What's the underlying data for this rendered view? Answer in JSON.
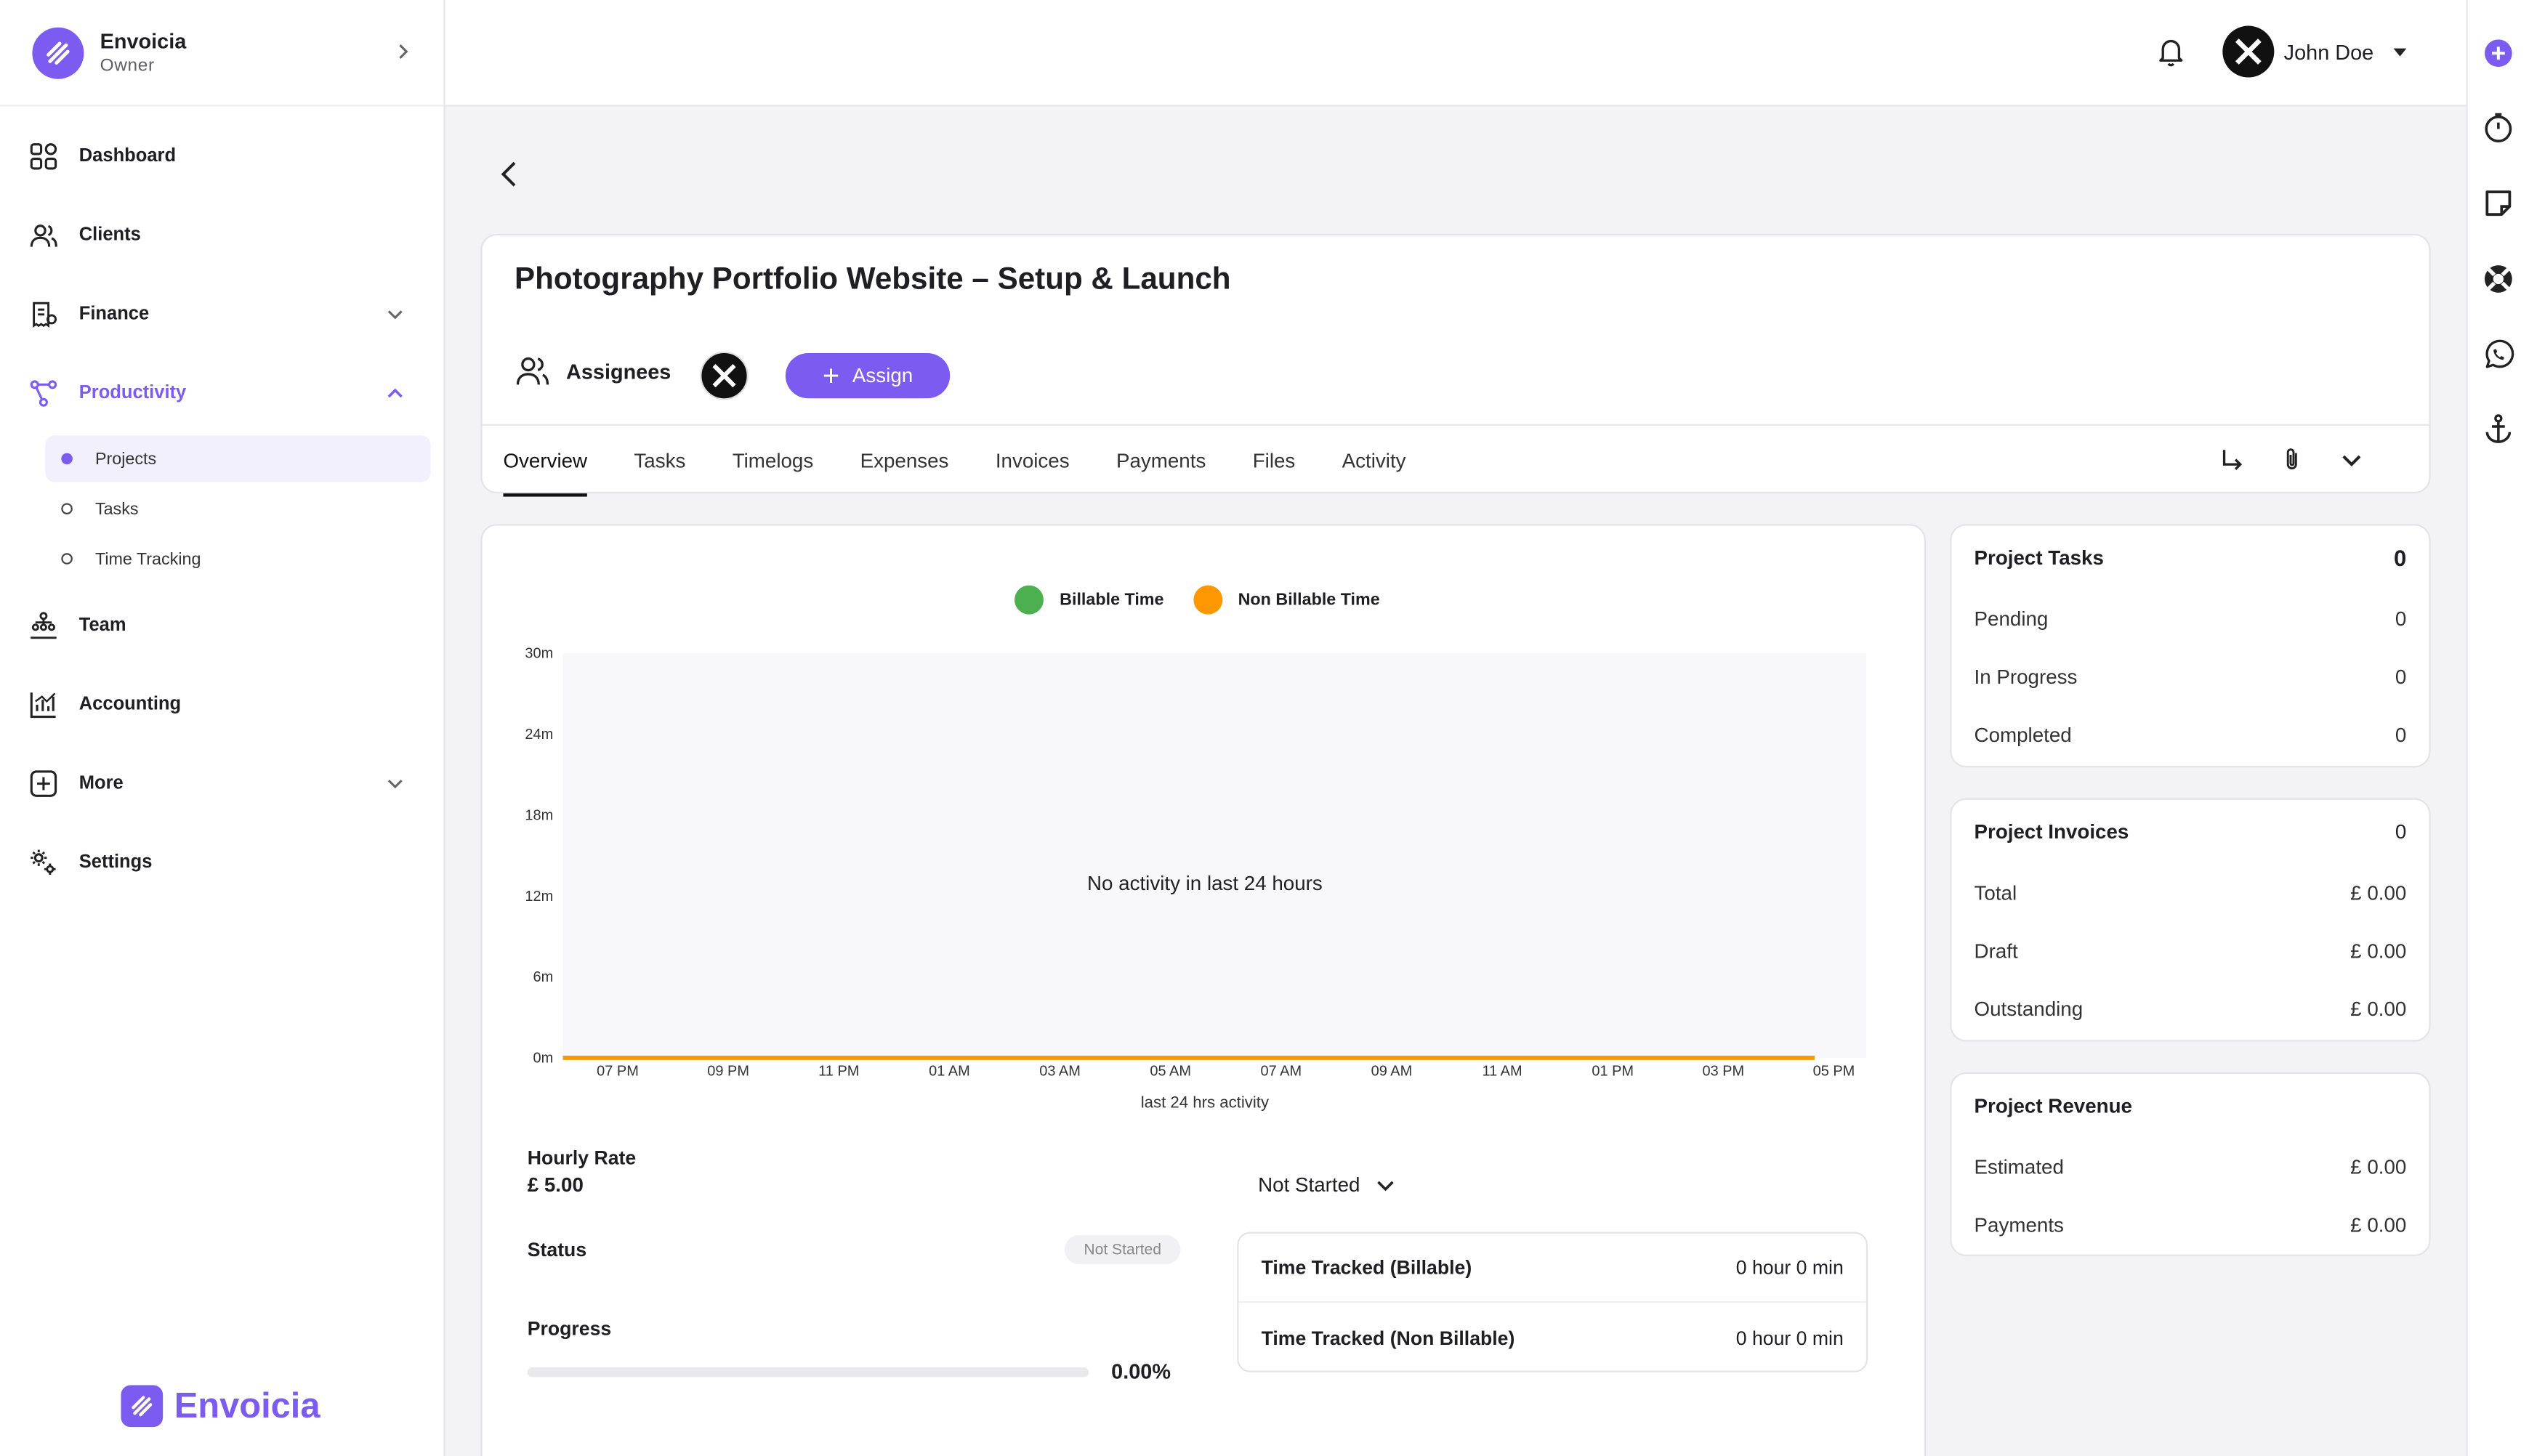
{
  "org": {
    "name": "Envoicia",
    "role": "Owner"
  },
  "nav": {
    "dashboard": "Dashboard",
    "clients": "Clients",
    "finance": "Finance",
    "productivity": "Productivity",
    "projects": "Projects",
    "tasks": "Tasks",
    "time_tracking": "Time Tracking",
    "team": "Team",
    "accounting": "Accounting",
    "more": "More",
    "settings": "Settings"
  },
  "brand": "Envoicia",
  "topbar": {
    "user_name": "John Doe"
  },
  "project": {
    "title": "Photography Portfolio Website – Setup & Launch",
    "assignees_label": "Assignees",
    "assign_label": "Assign"
  },
  "tabs": [
    "Overview",
    "Tasks",
    "Timelogs",
    "Expenses",
    "Invoices",
    "Payments",
    "Files",
    "Activity"
  ],
  "chart": {
    "legend_billable": "Billable Time",
    "legend_non_billable": "Non Billable Time",
    "empty_message": "No activity in last 24 hours",
    "xlabel": "last 24 hrs activity",
    "y_ticks": [
      "30m",
      "24m",
      "18m",
      "12m",
      "6m",
      "0m"
    ],
    "x_ticks": [
      "07 PM",
      "09 PM",
      "11 PM",
      "01 AM",
      "03 AM",
      "05 AM",
      "07 AM",
      "09 AM",
      "11 AM",
      "01 PM",
      "03 PM",
      "05 PM"
    ]
  },
  "chart_data": {
    "type": "line",
    "xlabel": "last 24 hrs activity",
    "ylabel": "",
    "x": [
      "07 PM",
      "09 PM",
      "11 PM",
      "01 AM",
      "03 AM",
      "05 AM",
      "07 AM",
      "09 AM",
      "11 AM",
      "01 PM",
      "03 PM",
      "05 PM"
    ],
    "ylim": [
      0,
      30
    ],
    "series": [
      {
        "name": "Billable Time",
        "values": [
          0,
          0,
          0,
          0,
          0,
          0,
          0,
          0,
          0,
          0,
          0,
          0
        ]
      },
      {
        "name": "Non Billable Time",
        "values": [
          0,
          0,
          0,
          0,
          0,
          0,
          0,
          0,
          0,
          0,
          0,
          0
        ]
      }
    ],
    "colors": {
      "Billable Time": "#4caf50",
      "Non Billable Time": "#ff9800"
    },
    "legend": "top-center"
  },
  "details": {
    "hourly_rate_label": "Hourly Rate",
    "hourly_rate_value": "£ 5.00",
    "status_label": "Status",
    "status_value": "Not Started",
    "status_select": "Not Started",
    "progress_label": "Progress",
    "progress_value": "0.00%",
    "progress_fraction": 0,
    "tt_billable_label": "Time Tracked (Billable)",
    "tt_billable_value": "0 hour 0 min",
    "tt_non_billable_label": "Time Tracked (Non Billable)",
    "tt_non_billable_value": "0 hour 0 min"
  },
  "project_tasks": {
    "title": "Project Tasks",
    "total": "0",
    "pending_label": "Pending",
    "pending": "0",
    "in_progress_label": "In Progress",
    "in_progress": "0",
    "completed_label": "Completed",
    "completed": "0"
  },
  "project_invoices": {
    "title": "Project Invoices",
    "total_count": "0",
    "total_label": "Total",
    "total": "£ 0.00",
    "draft_label": "Draft",
    "draft": "£ 0.00",
    "outstanding_label": "Outstanding",
    "outstanding": "£ 0.00"
  },
  "project_revenue": {
    "title": "Project Revenue",
    "estimated_label": "Estimated",
    "estimated": "£ 0.00",
    "payments_label": "Payments",
    "payments": "£ 0.00"
  },
  "colors": {
    "accent": "#7c5cf0",
    "billable": "#4caf50",
    "non_billable": "#ff9800"
  }
}
